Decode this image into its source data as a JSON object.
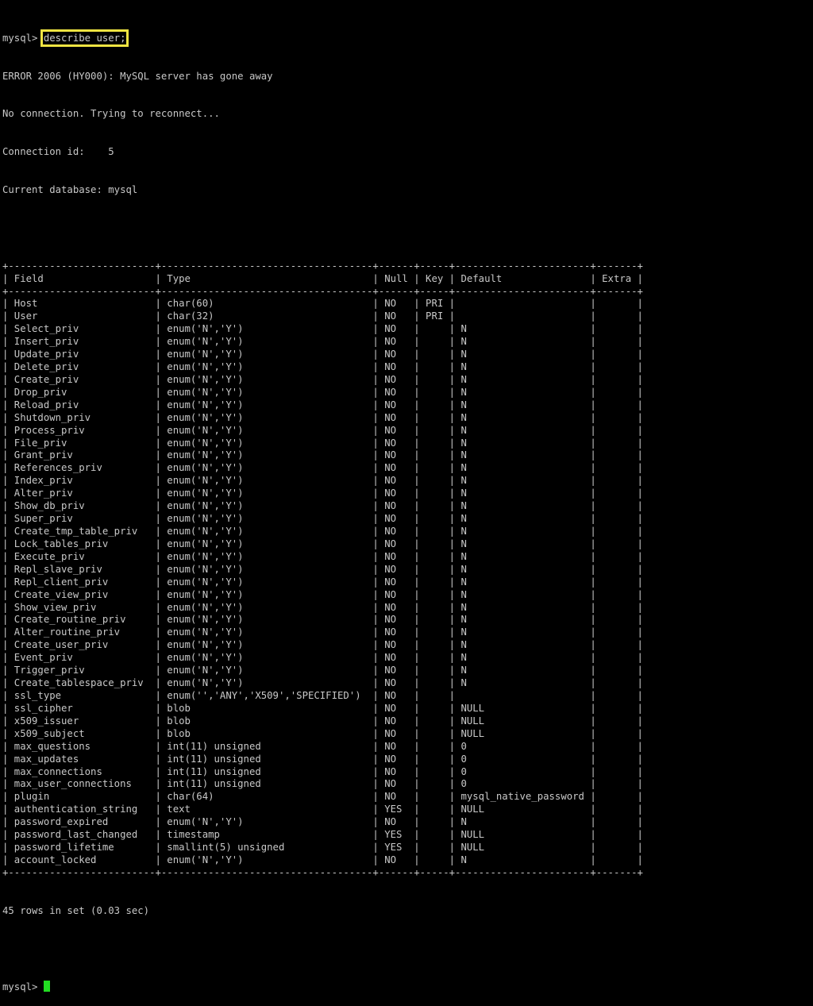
{
  "terminal": {
    "prompt": "mysql> ",
    "command": "describe user;",
    "messages": [
      "ERROR 2006 (HY000): MySQL server has gone away",
      "No connection. Trying to reconnect...",
      "Connection id:    5",
      "Current database: mysql"
    ],
    "table": {
      "separator": "+-------------------------+------------------------------------+------+-----+-----------------------+-------+",
      "headers": [
        "Field",
        "Type",
        "Null",
        "Key",
        "Default",
        "Extra"
      ],
      "rows": [
        [
          "Host",
          "char(60)",
          "NO",
          "PRI",
          "",
          ""
        ],
        [
          "User",
          "char(32)",
          "NO",
          "PRI",
          "",
          ""
        ],
        [
          "Select_priv",
          "enum('N','Y')",
          "NO",
          "",
          "N",
          ""
        ],
        [
          "Insert_priv",
          "enum('N','Y')",
          "NO",
          "",
          "N",
          ""
        ],
        [
          "Update_priv",
          "enum('N','Y')",
          "NO",
          "",
          "N",
          ""
        ],
        [
          "Delete_priv",
          "enum('N','Y')",
          "NO",
          "",
          "N",
          ""
        ],
        [
          "Create_priv",
          "enum('N','Y')",
          "NO",
          "",
          "N",
          ""
        ],
        [
          "Drop_priv",
          "enum('N','Y')",
          "NO",
          "",
          "N",
          ""
        ],
        [
          "Reload_priv",
          "enum('N','Y')",
          "NO",
          "",
          "N",
          ""
        ],
        [
          "Shutdown_priv",
          "enum('N','Y')",
          "NO",
          "",
          "N",
          ""
        ],
        [
          "Process_priv",
          "enum('N','Y')",
          "NO",
          "",
          "N",
          ""
        ],
        [
          "File_priv",
          "enum('N','Y')",
          "NO",
          "",
          "N",
          ""
        ],
        [
          "Grant_priv",
          "enum('N','Y')",
          "NO",
          "",
          "N",
          ""
        ],
        [
          "References_priv",
          "enum('N','Y')",
          "NO",
          "",
          "N",
          ""
        ],
        [
          "Index_priv",
          "enum('N','Y')",
          "NO",
          "",
          "N",
          ""
        ],
        [
          "Alter_priv",
          "enum('N','Y')",
          "NO",
          "",
          "N",
          ""
        ],
        [
          "Show_db_priv",
          "enum('N','Y')",
          "NO",
          "",
          "N",
          ""
        ],
        [
          "Super_priv",
          "enum('N','Y')",
          "NO",
          "",
          "N",
          ""
        ],
        [
          "Create_tmp_table_priv",
          "enum('N','Y')",
          "NO",
          "",
          "N",
          ""
        ],
        [
          "Lock_tables_priv",
          "enum('N','Y')",
          "NO",
          "",
          "N",
          ""
        ],
        [
          "Execute_priv",
          "enum('N','Y')",
          "NO",
          "",
          "N",
          ""
        ],
        [
          "Repl_slave_priv",
          "enum('N','Y')",
          "NO",
          "",
          "N",
          ""
        ],
        [
          "Repl_client_priv",
          "enum('N','Y')",
          "NO",
          "",
          "N",
          ""
        ],
        [
          "Create_view_priv",
          "enum('N','Y')",
          "NO",
          "",
          "N",
          ""
        ],
        [
          "Show_view_priv",
          "enum('N','Y')",
          "NO",
          "",
          "N",
          ""
        ],
        [
          "Create_routine_priv",
          "enum('N','Y')",
          "NO",
          "",
          "N",
          ""
        ],
        [
          "Alter_routine_priv",
          "enum('N','Y')",
          "NO",
          "",
          "N",
          ""
        ],
        [
          "Create_user_priv",
          "enum('N','Y')",
          "NO",
          "",
          "N",
          ""
        ],
        [
          "Event_priv",
          "enum('N','Y')",
          "NO",
          "",
          "N",
          ""
        ],
        [
          "Trigger_priv",
          "enum('N','Y')",
          "NO",
          "",
          "N",
          ""
        ],
        [
          "Create_tablespace_priv",
          "enum('N','Y')",
          "NO",
          "",
          "N",
          ""
        ],
        [
          "ssl_type",
          "enum('','ANY','X509','SPECIFIED')",
          "NO",
          "",
          "",
          ""
        ],
        [
          "ssl_cipher",
          "blob",
          "NO",
          "",
          "NULL",
          ""
        ],
        [
          "x509_issuer",
          "blob",
          "NO",
          "",
          "NULL",
          ""
        ],
        [
          "x509_subject",
          "blob",
          "NO",
          "",
          "NULL",
          ""
        ],
        [
          "max_questions",
          "int(11) unsigned",
          "NO",
          "",
          "0",
          ""
        ],
        [
          "max_updates",
          "int(11) unsigned",
          "NO",
          "",
          "0",
          ""
        ],
        [
          "max_connections",
          "int(11) unsigned",
          "NO",
          "",
          "0",
          ""
        ],
        [
          "max_user_connections",
          "int(11) unsigned",
          "NO",
          "",
          "0",
          ""
        ],
        [
          "plugin",
          "char(64)",
          "NO",
          "",
          "mysql_native_password",
          ""
        ],
        [
          "authentication_string",
          "text",
          "YES",
          "",
          "NULL",
          ""
        ],
        [
          "password_expired",
          "enum('N','Y')",
          "NO",
          "",
          "N",
          ""
        ],
        [
          "password_last_changed",
          "timestamp",
          "YES",
          "",
          "NULL",
          ""
        ],
        [
          "password_lifetime",
          "smallint(5) unsigned",
          "YES",
          "",
          "NULL",
          ""
        ],
        [
          "account_locked",
          "enum('N','Y')",
          "NO",
          "",
          "N",
          ""
        ]
      ]
    },
    "result_summary": "45 rows in set (0.03 sec)",
    "highlight_color": "#f0e442",
    "cursor_color": "#22dd22"
  }
}
